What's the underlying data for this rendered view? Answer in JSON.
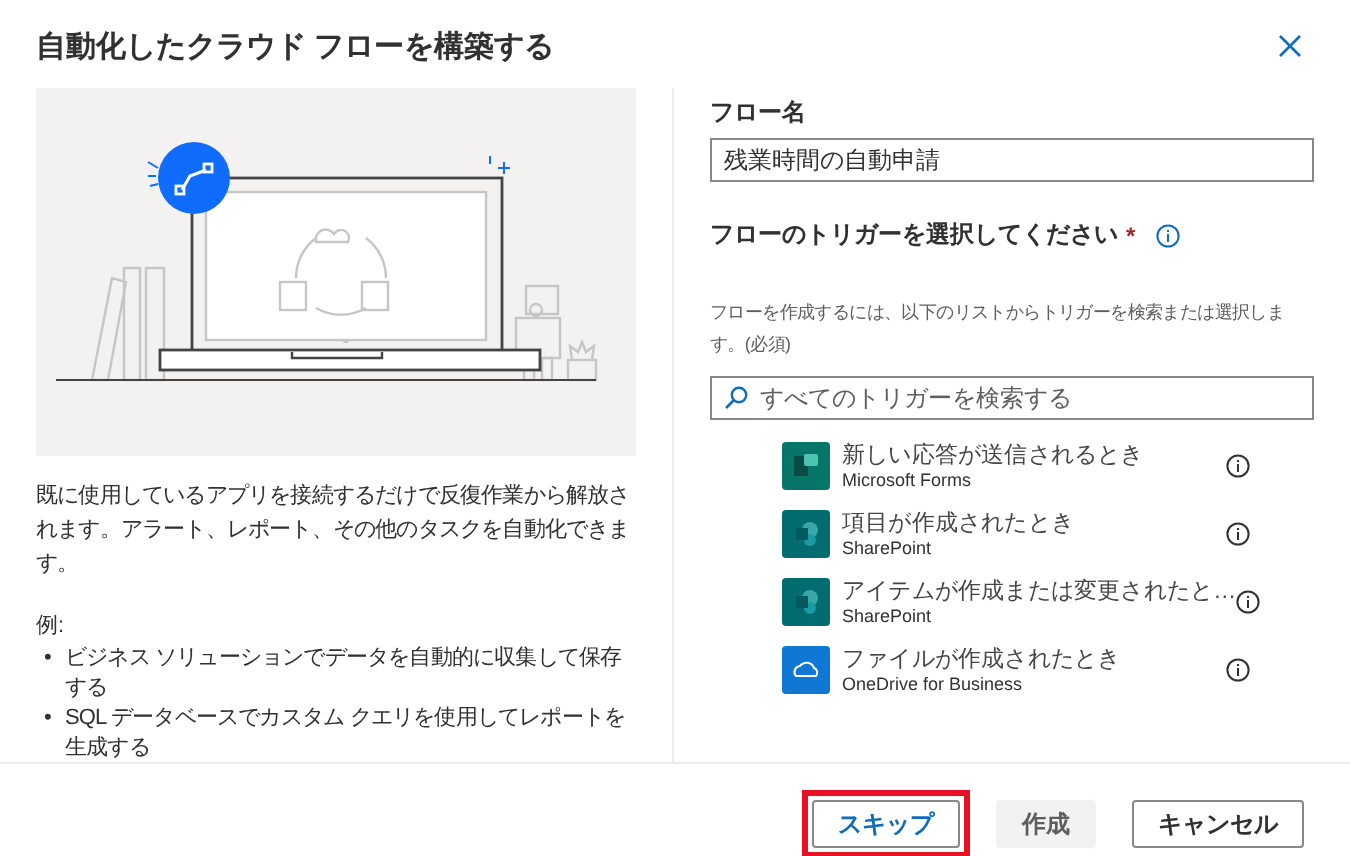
{
  "dialog": {
    "title": "自動化したクラウド フローを構築する"
  },
  "intro": {
    "description": "既に使用しているアプリを接続するだけで反復作業から解放されます。アラート、レポート、その他のタスクを自動化できます。",
    "examples_label": "例:",
    "examples": [
      {
        "marker": "•",
        "text": "ビジネス ソリューションでデータを自動的に収集して保存する"
      },
      {
        "marker": "•",
        "text": "SQL データベースでカスタム クエリを使用してレポートを生成する"
      }
    ]
  },
  "flow_name": {
    "label": "フロー名",
    "value": "残業時間の自動申請"
  },
  "trigger": {
    "label": "フローのトリガーを選択してください",
    "required": "*",
    "hint": "フローを作成するには、以下のリストからトリガーを検索または選択します。(必須)",
    "search_placeholder": "すべてのトリガーを検索する",
    "items": [
      {
        "title": "新しい応答が送信されるとき",
        "connector": "Microsoft Forms",
        "kind": "forms",
        "color": "#077568"
      },
      {
        "title": "項目が作成されたとき",
        "connector": "SharePoint",
        "kind": "sharepoint",
        "color": "#036c70"
      },
      {
        "title": "アイテムが作成または変更されたと…",
        "connector": "SharePoint",
        "kind": "sharepoint",
        "color": "#036c70"
      },
      {
        "title": "ファイルが作成されたとき",
        "connector": "OneDrive for Business",
        "kind": "onedrive",
        "color": "#0f78d4"
      }
    ]
  },
  "buttons": [
    {
      "label": "スキップ",
      "kind": "secondary",
      "disabled": false,
      "highlighted": true
    },
    {
      "label": "作成",
      "kind": "primary",
      "disabled": true,
      "highlighted": false
    },
    {
      "label": "キャンセル",
      "kind": "secondary",
      "disabled": false,
      "highlighted": false
    }
  ]
}
